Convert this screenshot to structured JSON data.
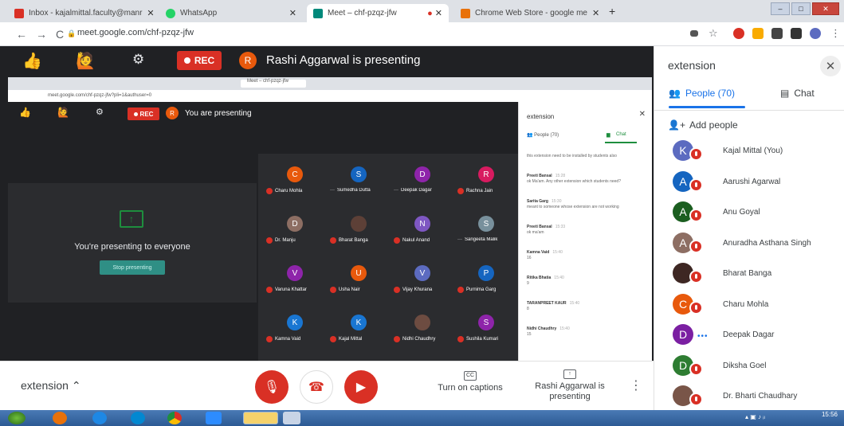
{
  "colors": {
    "meet_bg": "#202124",
    "tile_bg": "#2b2c2f",
    "rec_red": "#d93025",
    "accent_blue": "#1a73e8",
    "present_green": "#1e8e3e"
  },
  "browser": {
    "tabs": [
      {
        "label": "Inbox - kajalmittal.faculty@manr",
        "icon": "gmail-icon",
        "color": "#d93025"
      },
      {
        "label": "WhatsApp",
        "icon": "whatsapp-icon",
        "color": "#25d366"
      },
      {
        "label": "Meet – chf-pzqz-jfw",
        "icon": "meet-icon",
        "color": "#00897b"
      },
      {
        "label": "Chrome Web Store - google me",
        "icon": "webstore-icon",
        "color": "#e8710a"
      }
    ],
    "url": "meet.google.com/chf-pzqz-jfw"
  },
  "meet": {
    "rec_label": "REC",
    "presenter_initial": "R",
    "presenting_text": "Rashi Aggarwal is presenting"
  },
  "shared_screen": {
    "url": "meet.google.com/chf-pzqz-jfw?pli=1&authuser=0",
    "rec_label": "REC",
    "presenter_initial": "R",
    "presenting_text": "You are presenting",
    "presenting_everyone": "You're presenting to everyone",
    "stop_presenting": "Stop presenting",
    "tiles": [
      {
        "initial": "C",
        "name": "Charu Mohla",
        "color": "#e8590c",
        "muted": true
      },
      {
        "initial": "S",
        "name": "Sumedha Dutta",
        "color": "#1565c0",
        "muted": false
      },
      {
        "initial": "D",
        "name": "Deepak Dagar",
        "color": "#8e24aa",
        "muted": false
      },
      {
        "initial": "R",
        "name": "Rachna Jain",
        "color": "#d81b60",
        "muted": true
      },
      {
        "initial": "D",
        "name": "Dr. Manju",
        "color": "#8d6e63",
        "muted": true
      },
      {
        "initial": "",
        "name": "Bharat Banga",
        "color": "#5d4037",
        "muted": true
      },
      {
        "initial": "N",
        "name": "Nakul Anand",
        "color": "#7e57c2",
        "muted": true
      },
      {
        "initial": "S",
        "name": "Sangeeta Malik",
        "color": "#78909c",
        "muted": false
      },
      {
        "initial": "V",
        "name": "Varuna Khattar",
        "color": "#8e24aa",
        "muted": true
      },
      {
        "initial": "U",
        "name": "Usha Nair",
        "color": "#e8590c",
        "muted": true
      },
      {
        "initial": "V",
        "name": "Vijay Khurana",
        "color": "#5c6bc0",
        "muted": true
      },
      {
        "initial": "P",
        "name": "Purnima Garg",
        "color": "#1565c0",
        "muted": true
      },
      {
        "initial": "K",
        "name": "Kamna Vaid",
        "color": "#1976d2",
        "muted": true
      },
      {
        "initial": "K",
        "name": "Kajal Mittal",
        "color": "#1976d2",
        "muted": true
      },
      {
        "initial": "",
        "name": "Nidhi Chaudhry",
        "color": "#6d4c41",
        "muted": true
      },
      {
        "initial": "S",
        "name": "Sushila Kumari",
        "color": "#8e24aa",
        "muted": true
      }
    ],
    "panel": {
      "title": "extension",
      "people_tab": "People (70)",
      "chat_tab": "Chat",
      "messages": [
        {
          "name": "",
          "time": "",
          "text": "this extension need to be installed by students also"
        },
        {
          "name": "Preeti Bansal",
          "time": "15:28",
          "text": "ok Ma'am. Any other extension which students need?"
        },
        {
          "name": "Sarita Garg",
          "time": "15:30",
          "text": "meant to someone whose extension are not working"
        },
        {
          "name": "Preeti Bansal",
          "time": "15:33",
          "text": "ok ma'am"
        },
        {
          "name": "Kamna Vaid",
          "time": "15:40",
          "text": "16"
        },
        {
          "name": "Ritika Bhatia",
          "time": "15:40",
          "text": "9"
        },
        {
          "name": "TARANPREET KAUR",
          "time": "15:40",
          "text": "8"
        },
        {
          "name": "Nidhi Chaudhry",
          "time": "15:40",
          "text": "15"
        }
      ]
    }
  },
  "controls": {
    "extension_label": "extension",
    "captions_label": "Turn on captions",
    "present_label": "Rashi Aggarwal is presenting"
  },
  "side_panel": {
    "title": "extension",
    "people_tab": "People (70)",
    "chat_tab": "Chat",
    "add_people": "Add people",
    "people": [
      {
        "initial": "K",
        "name": "Kajal Mittal (You)",
        "color": "#5c6bc0",
        "muted": true
      },
      {
        "initial": "A",
        "name": "Aarushi Agarwal",
        "color": "#1565c0",
        "muted": true
      },
      {
        "initial": "A",
        "name": "Anu Goyal",
        "color": "#1b5e20",
        "muted": true
      },
      {
        "initial": "A",
        "name": "Anuradha Asthana Singh",
        "color": "#8d6e63",
        "muted": true
      },
      {
        "initial": "",
        "name": "Bharat Banga",
        "color": "#3e2723",
        "muted": true
      },
      {
        "initial": "C",
        "name": "Charu Mohla",
        "color": "#e8590c",
        "muted": true
      },
      {
        "initial": "D",
        "name": "Deepak Dagar",
        "color": "#7b1fa2",
        "muted": false
      },
      {
        "initial": "D",
        "name": "Diksha Goel",
        "color": "#2e7d32",
        "muted": true
      },
      {
        "initial": "",
        "name": "Dr. Bharti Chaudhary",
        "color": "#795548",
        "muted": true
      }
    ]
  },
  "taskbar": {
    "time": "15:56"
  }
}
